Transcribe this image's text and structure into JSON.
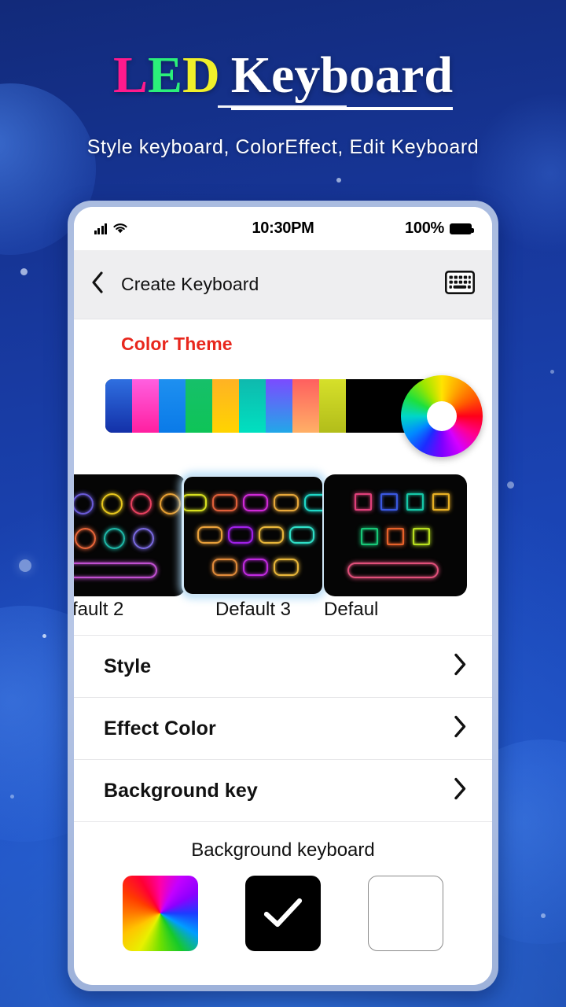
{
  "promo": {
    "title_led": "LED",
    "title_keyboard": "Keyboard",
    "subtitle": "Style keyboard, ColorEffect, Edit Keyboard",
    "led_colors": [
      "#ff1a8c",
      "#2bf07a",
      "#f0f02a"
    ],
    "keyboard_color": "#ffffff",
    "background_color": "#1a44b4"
  },
  "statusbar": {
    "signal_icon": "signal-bars-icon",
    "wifi_icon": "wifi-icon",
    "time": "10:30PM",
    "battery_percent": "100%",
    "battery_icon": "battery-full-icon"
  },
  "appbar": {
    "back_icon": "chevron-left-icon",
    "title": "Create Keyboard",
    "action_icon": "keyboard-icon"
  },
  "color_theme": {
    "title": "Color Theme",
    "title_color": "#e8271d",
    "swatches": [
      {
        "name": "blue-gradient",
        "from": "#2f6fe0",
        "to": "#1330a8"
      },
      {
        "name": "magenta",
        "from": "#ff5fe0",
        "to": "#ff1fa0"
      },
      {
        "name": "azure",
        "from": "#1e90f0",
        "to": "#0a7ae8"
      },
      {
        "name": "green",
        "from": "#16c06a",
        "to": "#0ec457"
      },
      {
        "name": "amber",
        "from": "#ffb224",
        "to": "#ffd400"
      },
      {
        "name": "teal",
        "from": "#0fb9ae",
        "to": "#00e0c0"
      },
      {
        "name": "violet",
        "from": "#7b4bff",
        "to": "#22a8e8"
      },
      {
        "name": "coral",
        "from": "#ff5f5f",
        "to": "#ffb066"
      },
      {
        "name": "lime",
        "from": "#d6e02a",
        "to": "#b2bd1a"
      }
    ],
    "fill_color": "#000000",
    "wheel_icon": "color-wheel-picker"
  },
  "keyboard_presets": [
    {
      "label": "fault 2",
      "name": "preset-default-2",
      "selected": false,
      "shape": "circle",
      "rows": [
        [
          "#6a5bd8",
          "#e8c81e",
          "#e8415f",
          "#e8a033"
        ],
        [
          "#e8663a",
          "#1fb8a8",
          "#7a6ae0"
        ],
        [
          "spacebar-#c050d0"
        ]
      ]
    },
    {
      "label": "Default 3",
      "name": "preset-default-3",
      "selected": true,
      "shape": "rounded-rect",
      "rows": [
        [
          "#d8e020",
          "#e0603a",
          "#d02ad8",
          "#e8a83a",
          "#1fd8c8"
        ],
        [
          "#e8a03a",
          "#a020e8",
          "#e8b63a",
          "#2fe0c8"
        ],
        [
          "#e08a3a",
          "#c02ae0",
          "#e8b63a"
        ]
      ]
    },
    {
      "label": "Defaul",
      "name": "preset-default-4",
      "selected": false,
      "shape": "square",
      "rows": [
        [
          "#e0407a",
          "#3a58e0",
          "#16c8a8",
          "#e8b024"
        ],
        [
          "#18c878",
          "#e8622a",
          "#b8e020"
        ],
        [
          "spacebar-#e0507a"
        ]
      ]
    }
  ],
  "menu": [
    {
      "label": "Style",
      "name": "menu-style",
      "chevron": "chevron-right-icon"
    },
    {
      "label": "Effect Color",
      "name": "menu-effect-color",
      "chevron": "chevron-right-icon"
    },
    {
      "label": "Background key",
      "name": "menu-background-key",
      "chevron": "chevron-right-icon"
    }
  ],
  "background_keyboard": {
    "title": "Background keyboard",
    "options": [
      {
        "name": "bg-color-wheel",
        "type": "color-wheel",
        "selected": false
      },
      {
        "name": "bg-black",
        "type": "black",
        "selected": true,
        "check_icon": "check-icon"
      },
      {
        "name": "bg-none",
        "type": "empty",
        "selected": false
      }
    ]
  }
}
